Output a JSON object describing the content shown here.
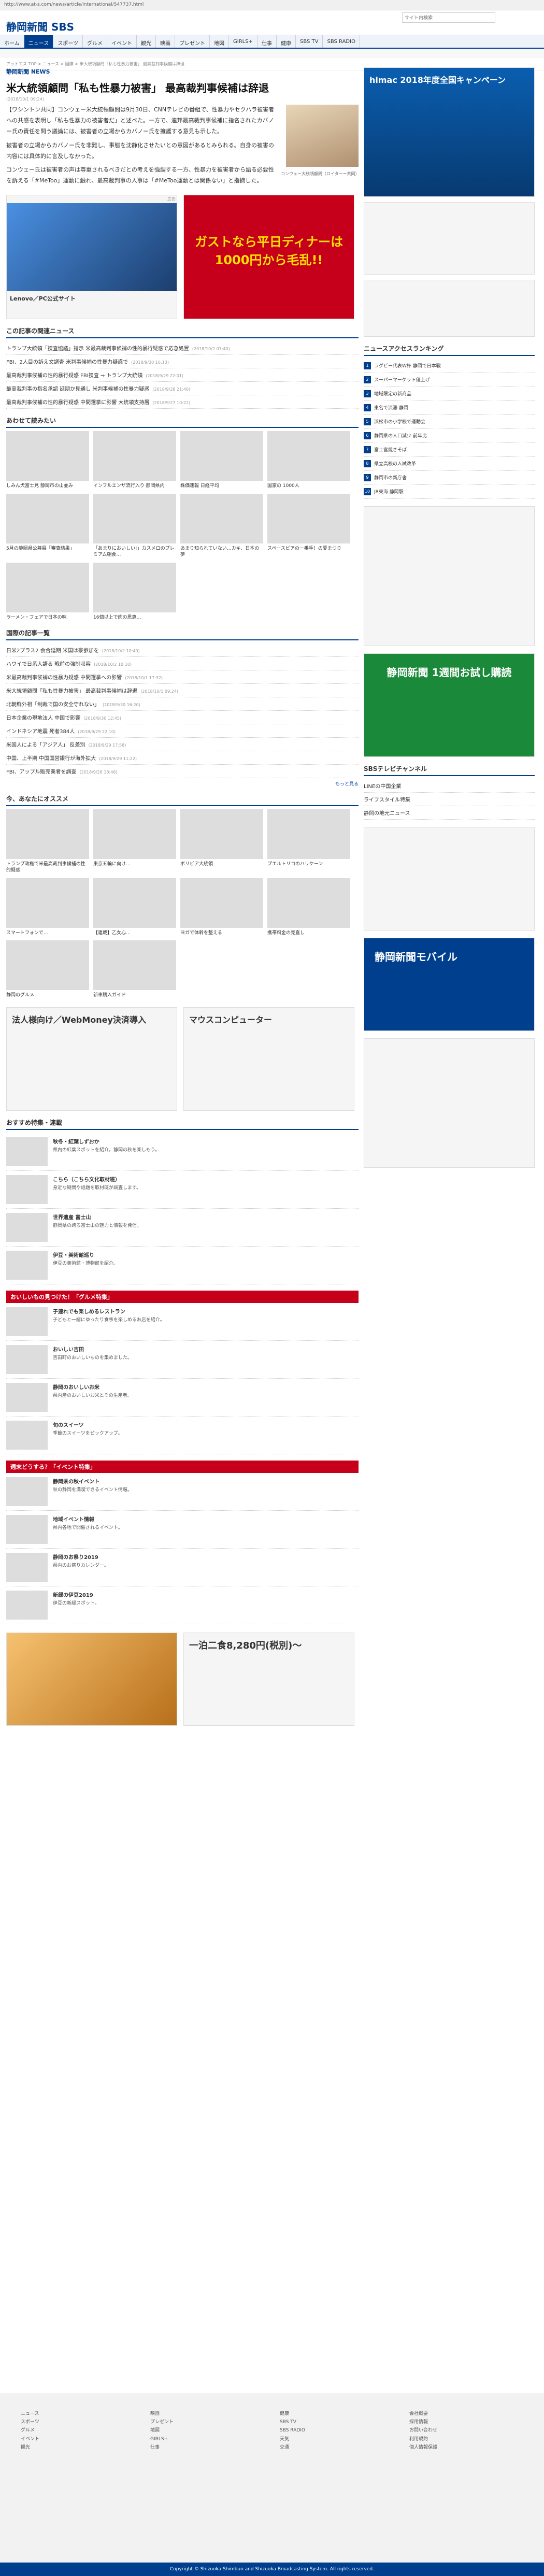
{
  "url": "http://www.at-s.com/news/article/international/547737.html",
  "site": {
    "logo": "静岡新聞 SBS",
    "search_placeholder": "サイト内検索"
  },
  "nav": [
    "ホーム",
    "ニュース",
    "スポーツ",
    "グルメ",
    "イベント",
    "観光",
    "映画",
    "プレゼント",
    "地図",
    "GIRLS+",
    "仕事",
    "健康",
    "SBS TV",
    "SBS RADIO"
  ],
  "breadcrumb": "アットエス TOP > ニュース > 国際 > 米大統領顧問「私も性暴力被害」 最高裁判事候補は辞退",
  "article": {
    "source": "静岡新聞 NEWS",
    "title": "米大統領顧問「私も性暴力被害」 最高裁判事候補は辞退",
    "date": "(2018/10/1 09:24)",
    "p1": "【ワシントン共同】コンウェー米大統領顧問は9月30日、CNNテレビの番組で、性暴力やセクハラ被害者への共感を表明し「私も性暴力の被害者だ」と述べた。一方で、連邦最高裁判事候補に指名されたカバノー氏の責任を問う議論には、被害者の立場からカバノー氏を擁護する意見も示した。",
    "p2": "被害者の立場からカバノー氏を非難し、事態を沈静化させたいとの意図があるとみられる。自身の被害の内容には具体的に言及しなかった。",
    "p3": "コンウェー氏は被害者の声は尊重されるべきだとの考えを強調する一方、性暴力を被害者から語る必要性を訴える「#MeToo」運動に触れ、最高裁判事の人事は「#MeToo運動とは関係ない」と指摘した。",
    "caption": "コンウェー大統領顧問（ロイター＝共同）"
  },
  "related": {
    "title": "この記事の関連ニュース",
    "items": [
      {
        "t": "トランプ大統領「捜査協議」指示 米最高裁判事候補の性的暴行疑惑で応急処置",
        "d": "(2018/10/2 07:40)"
      },
      {
        "t": "FBI、2人目の訴え文調査 米判事候補の性暴力疑惑で",
        "d": "(2018/9/30 16:13)"
      },
      {
        "t": "最高裁判事候補の性的暴行疑惑 FBI捜査 ⇒ トランプ大統領",
        "d": "(2018/9/29 22:01)"
      },
      {
        "t": "最高裁判事の指名承認 延期か見通し 米判事候補の性暴力疑惑",
        "d": "(2018/9/28 21:40)"
      },
      {
        "t": "最高裁判事候補の性的暴行疑惑 中間選挙に影響 大統領支持層",
        "d": "(2018/9/27 10:22)"
      }
    ]
  },
  "readalso": {
    "title": "あわせて読みたい",
    "items": [
      "しみん犬富士見 静岡市の山並み",
      "インフルエンザ流行入り 静岡県内",
      "株価速報 日経平均",
      "国家の 1000人",
      "5月の静岡県公募展「審査結果」",
      "「あまりにおいしい!」カスメロのプレミアム朝食…",
      "あまり知られていない…カキ、日本の夢",
      "スペースピアの一番手！の夏まつり",
      "ラーメン・フェアで日本の味",
      "16個以上で肉の恩恵…"
    ]
  },
  "international": {
    "title": "国際の記事一覧",
    "items": [
      {
        "t": "日米2プラス2 会合延期 米国は豪参加を",
        "d": "(2018/10/2 10:40)"
      },
      {
        "t": "ハワイで日系人語る 戦前の強制収容",
        "d": "(2018/10/2 10:10)"
      },
      {
        "t": "米最高裁判事候補の性暴力疑惑 中間選挙への影響",
        "d": "(2018/10/1 17:32)"
      },
      {
        "t": "米大統領顧問「私も性暴力被害」 最高裁判事候補は辞退",
        "d": "(2018/10/1 09:24)"
      },
      {
        "t": "北朝鮮外相「制裁で国の安全守れない」",
        "d": "(2018/9/30 16:20)"
      },
      {
        "t": "日本企業の現地法人 中国で影響",
        "d": "(2018/9/30 12:45)"
      },
      {
        "t": "インドネシア地震 死者384人",
        "d": "(2018/9/29 22:10)"
      },
      {
        "t": "米国人による「アジア人」 反差別",
        "d": "(2018/9/29 17:58)"
      },
      {
        "t": "中国、上半期 中国国営銀行が海外拡大",
        "d": "(2018/9/29 11:22)"
      },
      {
        "t": "FBI、アップル販売業者を調査",
        "d": "(2018/9/28 18:46)"
      }
    ],
    "more": "もっと見る"
  },
  "recommend": {
    "title": "今、あなたにオススメ",
    "items": [
      "トランプ政権で米最高裁判事候補の性的疑惑",
      "東京五輪に向け…",
      "ボリビア大統領",
      "プエルトリコのハリケーン",
      "スマートフォンで…",
      "【連載】乙女心…",
      "ヨガで体幹を整える",
      "携帯料金の見直し",
      "静岡のグルメ",
      "新車購入ガイド"
    ]
  },
  "features": {
    "title": "おすすめ特集・連載",
    "items": [
      {
        "t": "秋冬・紅葉しずおか",
        "d": "県内の紅葉スポットを紹介。静岡の秋を楽しもう。"
      },
      {
        "t": "こちら（こちら文化取材班）",
        "d": "身近な疑問や話題を取材班が調査します。"
      },
      {
        "t": "世界遺産 富士山",
        "d": "静岡県の誇る富士山の魅力と情報を発信。"
      },
      {
        "t": "伊豆・美術館巡り",
        "d": "伊豆の美術館・博物館を紹介。"
      }
    ]
  },
  "gourmet": {
    "title": "おいしいもの見つけた！「グルメ特集」",
    "items": [
      {
        "t": "子連れでも楽しめるレストラン",
        "d": "子どもと一緒にゆったり食事を楽しめるお店を紹介。"
      },
      {
        "t": "おいしい吉田",
        "d": "吉田町のおいしいものを集めました。"
      },
      {
        "t": "静岡のおいしいお米",
        "d": "県内産のおいしいお米とその生産者。"
      },
      {
        "t": "旬のスイーツ",
        "d": "季節のスイーツをピックアップ。"
      }
    ]
  },
  "events": {
    "title": "週末どうする？「イベント特集」",
    "items": [
      {
        "t": "静岡県の秋イベント",
        "d": "秋の静岡を満喫できるイベント情報。"
      },
      {
        "t": "地域イベント情報",
        "d": "県内各地で開催されるイベント。"
      },
      {
        "t": "静岡のお祭り2019",
        "d": "県内のお祭りカレンダー。"
      },
      {
        "t": "新緑の伊豆2019",
        "d": "伊豆の新緑スポット。"
      }
    ]
  },
  "ranking": {
    "title": "ニュースアクセスランキング",
    "items": [
      "ラグビー代表W杯 静岡で日本戦",
      "スーパーマーケット値上げ",
      "地域限定の新商品",
      "東名で渋滞 静岡",
      "浜松市の小学校で運動会",
      "静岡県の人口減少 前年比",
      "富士宮焼きそば",
      "県立高校の入試改革",
      "静岡市の新庁舎",
      "JR東海 静岡駅"
    ]
  },
  "sbs_tv": {
    "title": "SBSテレビチャンネル",
    "items": [
      "LINEの中国企業",
      "ライフスタイル特集",
      "静岡の地元ニュース"
    ]
  },
  "ads": {
    "himac": "himac 2018年度全国キャンペーン",
    "gusto": "ガストなら平日ディナーは1000円から毛乱!!",
    "lenovo": "Lenovo／PC公式サイト",
    "webmoney": "法人様向け／WebMoney決済導入",
    "mouse": "マウスコンピューター",
    "hotel": "一泊二食8,280円(税別)〜",
    "shizuoka": "静岡新聞 1週間お試し購読",
    "mobile": "静岡新聞モバイル",
    "label": "広告"
  },
  "footer": {
    "cols": [
      [
        "ニュース",
        "スポーツ",
        "グルメ",
        "イベント",
        "観光"
      ],
      [
        "映画",
        "プレゼント",
        "地図",
        "GIRLS+",
        "仕事"
      ],
      [
        "健康",
        "SBS TV",
        "SBS RADIO",
        "天気",
        "交通"
      ],
      [
        "会社概要",
        "採用情報",
        "お問い合わせ",
        "利用規約",
        "個人情報保護"
      ]
    ],
    "copy": "Copyright © Shizuoka Shimbun and Shizuoka Broadcasting System. All rights reserved."
  }
}
